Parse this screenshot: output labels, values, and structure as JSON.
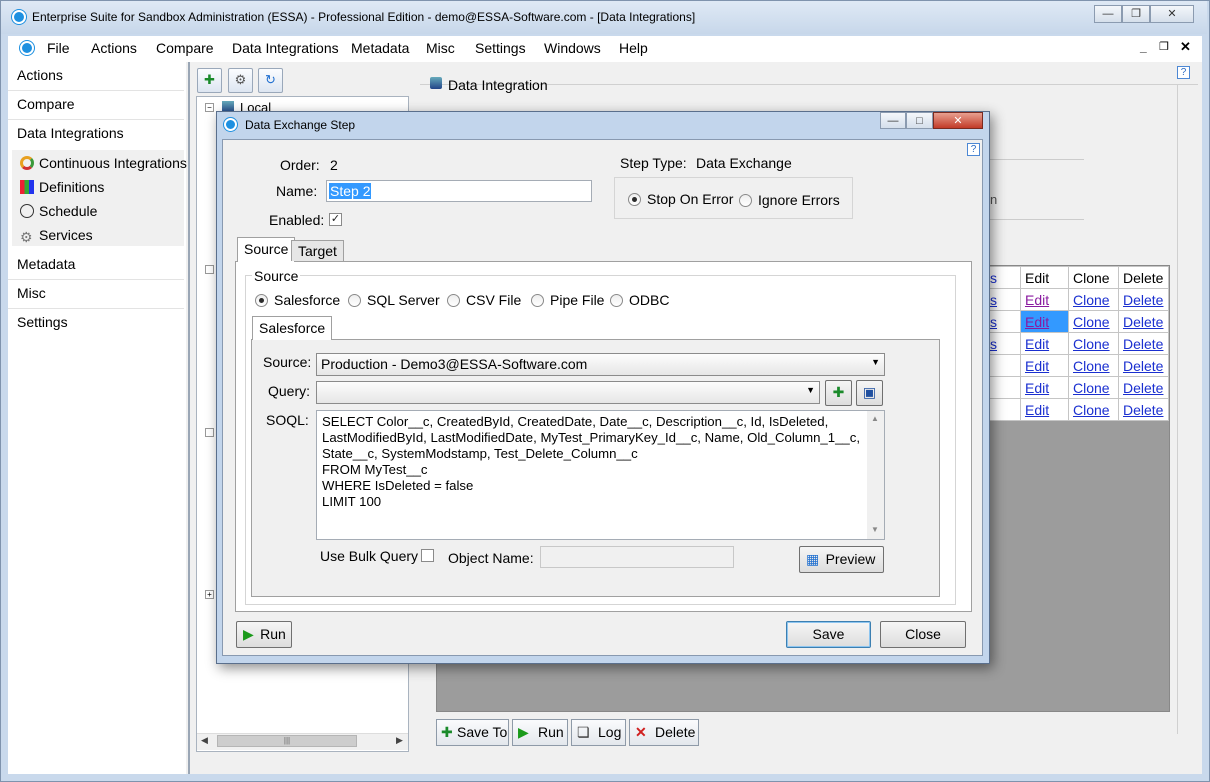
{
  "app": {
    "title": "Enterprise Suite for Sandbox Administration (ESSA) - Professional Edition - demo@ESSA-Software.com - [Data Integrations]"
  },
  "menu": [
    "File",
    "Actions",
    "Compare",
    "Data Integrations",
    "Metadata",
    "Misc",
    "Settings",
    "Windows",
    "Help"
  ],
  "nav": {
    "headers": [
      "Actions",
      "Compare",
      "Data Integrations"
    ],
    "sub_items": [
      "Continuous Integrations",
      "Definitions",
      "Schedule",
      "Services"
    ],
    "lower_headers": [
      "Metadata",
      "Misc",
      "Settings"
    ]
  },
  "tree": {
    "root": "Local"
  },
  "pane": {
    "title": "Data Integration",
    "grid_headers": [
      "Edit",
      "Clone",
      "Delete"
    ],
    "grid_rows": [
      [
        "Edit",
        "Clone",
        "Delete"
      ],
      [
        "Edit",
        "Clone",
        "Delete"
      ],
      [
        "Edit",
        "Clone",
        "Delete"
      ],
      [
        "Edit",
        "Clone",
        "Delete"
      ],
      [
        "Edit",
        "Clone",
        "Delete"
      ],
      [
        "Edit",
        "Clone",
        "Delete"
      ]
    ],
    "buttons": {
      "save_to": "Save To",
      "run": "Run",
      "log": "Log",
      "delete": "Delete"
    }
  },
  "dialog": {
    "title": "Data Exchange Step",
    "order_label": "Order:",
    "order_value": "2",
    "name_label": "Name:",
    "name_value": "Step 2",
    "enabled_label": "Enabled:",
    "step_type_label": "Step Type:",
    "step_type_value": "Data Exchange",
    "stop_on_error": "Stop On Error",
    "ignore_errors": "Ignore Errors",
    "tabs": [
      "Source",
      "Target"
    ],
    "source_group": "Source",
    "source_options": [
      "Salesforce",
      "SQL Server",
      "CSV File",
      "Pipe File",
      "ODBC"
    ],
    "inner_tab": "Salesforce",
    "source_label": "Source:",
    "source_value": "Production - Demo3@ESSA-Software.com",
    "query_label": "Query:",
    "soql_label": "SOQL:",
    "soql_lines": [
      "SELECT Color__c, CreatedById, CreatedDate, Date__c, Description__c, Id, IsDeleted,",
      "LastModifiedById, LastModifiedDate, MyTest_PrimaryKey_Id__c, Name, Old_Column_1__c,",
      "State__c, SystemModstamp, Test_Delete_Column__c",
      "FROM MyTest__c",
      "WHERE IsDeleted = false",
      "LIMIT 100"
    ],
    "use_bulk_query": "Use Bulk Query",
    "object_name_label": "Object Name:",
    "preview": "Preview",
    "run": "Run",
    "save": "Save",
    "close": "Close"
  },
  "colors": {
    "accent": "#1e90e0",
    "selection": "#3399ff",
    "link": "#1a2fd0"
  }
}
